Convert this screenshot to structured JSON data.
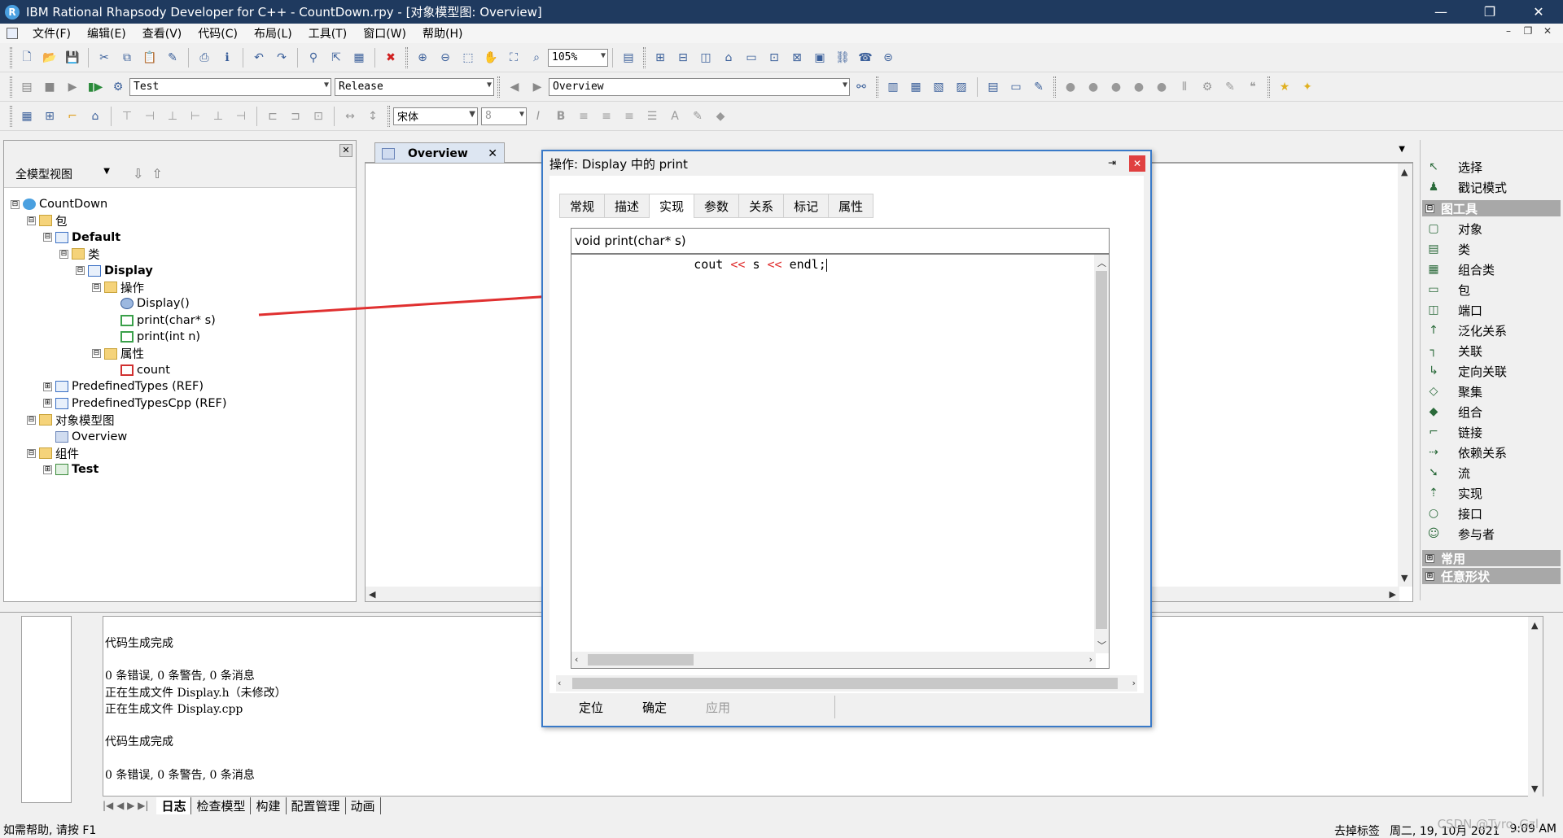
{
  "window": {
    "title": "IBM Rational Rhapsody Developer for C++ - CountDown.rpy - [对象模型图: Overview]",
    "controls": [
      "—",
      "❐",
      "✕"
    ]
  },
  "menu": [
    "文件(F)",
    "编辑(E)",
    "查看(V)",
    "代码(C)",
    "布局(L)",
    "工具(T)",
    "窗口(W)",
    "帮助(H)"
  ],
  "toolbar": {
    "zoom_value": "105%",
    "config_value": "Test",
    "build_value": "Release",
    "diagram_value": "Overview",
    "font_value": "宋体",
    "font_size_value": "8"
  },
  "browser": {
    "view_selector": "全模型视图",
    "tree": [
      {
        "label": "CountDown",
        "level": 0,
        "icon": "project-icon",
        "expander": "⊟",
        "bold": false
      },
      {
        "label": "包",
        "level": 1,
        "icon": "folder-icon",
        "expander": "⊟",
        "bold": false
      },
      {
        "label": "Default",
        "level": 2,
        "icon": "package-icon",
        "expander": "⊟",
        "bold": true
      },
      {
        "label": "类",
        "level": 3,
        "icon": "folder-icon",
        "expander": "⊟",
        "bold": false
      },
      {
        "label": "Display",
        "level": 4,
        "icon": "class-icon",
        "expander": "⊟",
        "bold": true
      },
      {
        "label": "操作",
        "level": 5,
        "icon": "folder-icon",
        "expander": "⊟",
        "bold": false
      },
      {
        "label": "Display()",
        "level": 6,
        "icon": "constructor-icon",
        "expander": "",
        "bold": false
      },
      {
        "label": "print(char* s)",
        "level": 6,
        "icon": "operation-icon",
        "expander": "",
        "bold": false
      },
      {
        "label": "print(int n)",
        "level": 6,
        "icon": "operation-icon",
        "expander": "",
        "bold": false
      },
      {
        "label": "属性",
        "level": 5,
        "icon": "folder-icon",
        "expander": "⊟",
        "bold": false
      },
      {
        "label": "count",
        "level": 6,
        "icon": "attribute-icon",
        "expander": "",
        "bold": false
      },
      {
        "label": "PredefinedTypes (REF)",
        "level": 2,
        "icon": "package-icon",
        "expander": "⊞",
        "bold": false
      },
      {
        "label": "PredefinedTypesCpp (REF)",
        "level": 2,
        "icon": "package-icon",
        "expander": "⊞",
        "bold": false
      },
      {
        "label": "对象模型图",
        "level": 1,
        "icon": "folder-icon",
        "expander": "⊟",
        "bold": false
      },
      {
        "label": "Overview",
        "level": 2,
        "icon": "diagram-icon",
        "expander": "",
        "bold": false
      },
      {
        "label": "组件",
        "level": 1,
        "icon": "folder-icon",
        "expander": "⊟",
        "bold": false
      },
      {
        "label": "Test",
        "level": 2,
        "icon": "component-icon",
        "expander": "⊞",
        "bold": true
      }
    ]
  },
  "editor_tab": {
    "label": "Overview"
  },
  "dialog": {
    "title": "操作:  Display 中的 print",
    "tabs": [
      "常规",
      "描述",
      "实现",
      "参数",
      "关系",
      "标记",
      "属性"
    ],
    "active_tab": "实现",
    "signature": "void print(char* s)",
    "code": {
      "indent": "      ",
      "lhs": "cout",
      "op1": "<<",
      "var": "s",
      "op2": "<<",
      "rhs": "endl;"
    },
    "buttons": {
      "locate": "定位",
      "ok": "确定",
      "apply": "应用"
    }
  },
  "toolbox": {
    "top_items": [
      {
        "label": "选择",
        "icon": "arrow-icon"
      },
      {
        "label": "戳记模式",
        "icon": "stamp-icon"
      }
    ],
    "groups": [
      {
        "label": "图工具",
        "expander": "⊟",
        "items": [
          {
            "label": "对象",
            "icon": "object-icon"
          },
          {
            "label": "类",
            "icon": "class-icon"
          },
          {
            "label": "组合类",
            "icon": "composite-class-icon"
          },
          {
            "label": "包",
            "icon": "package-icon"
          },
          {
            "label": "端口",
            "icon": "port-icon"
          },
          {
            "label": "泛化关系",
            "icon": "generalization-icon"
          },
          {
            "label": "关联",
            "icon": "association-icon"
          },
          {
            "label": "定向关联",
            "icon": "directed-association-icon"
          },
          {
            "label": "聚集",
            "icon": "aggregation-icon"
          },
          {
            "label": "组合",
            "icon": "composition-icon"
          },
          {
            "label": "链接",
            "icon": "link-icon"
          },
          {
            "label": "依赖关系",
            "icon": "dependency-icon"
          },
          {
            "label": "流",
            "icon": "flow-icon"
          },
          {
            "label": "实现",
            "icon": "realization-icon"
          },
          {
            "label": "接口",
            "icon": "interface-icon"
          },
          {
            "label": "参与者",
            "icon": "actor-icon"
          }
        ]
      },
      {
        "label": "常用",
        "expander": "⊞",
        "items": []
      },
      {
        "label": "任意形状",
        "expander": "⊞",
        "items": []
      }
    ]
  },
  "output": {
    "lines": [
      "代码生成完成",
      "",
      "0 条错误, 0 条警告, 0 条消息",
      "正在生成文件 Display.h（未修改）",
      "正在生成文件 Display.cpp",
      "",
      "代码生成完成",
      "",
      "0 条错误, 0 条警告, 0 条消息"
    ],
    "tabs": [
      "日志",
      "检查模型",
      "构建",
      "配置管理",
      "动画"
    ],
    "active_tab": "日志"
  },
  "status": {
    "help": "如需帮助, 请按 F1",
    "right_label": "去掉标签",
    "datetime": "周二, 19, 10月 2021",
    "time": "9:09 AM"
  },
  "watermark": "CSDN @Tyro_Gzl",
  "colors": {
    "titlebar": "#1f3a5f",
    "accent": "#3a7ac8",
    "arrow": "#e03030"
  }
}
